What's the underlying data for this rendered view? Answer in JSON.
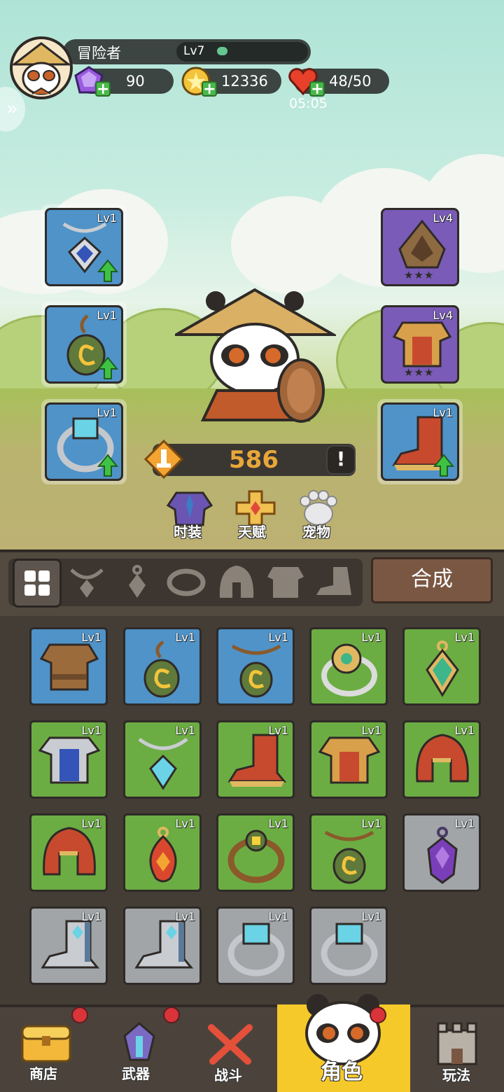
{
  "player": {
    "name": "冒险者",
    "level": "Lv7",
    "level_progress": 0.12,
    "gems": "90",
    "coins": "12336",
    "energy": "48/50",
    "energy_timer": "05:05"
  },
  "equipped": {
    "left": [
      {
        "item": "necklace-blue",
        "level": "Lv1",
        "upgradable": true
      },
      {
        "item": "pendant-green",
        "level": "Lv1",
        "upgradable": true
      },
      {
        "item": "ring-silver",
        "level": "Lv1",
        "upgradable": true
      }
    ],
    "right": [
      {
        "item": "hood-green",
        "level": "Lv4",
        "stars": "★★★",
        "upgradable": false
      },
      {
        "item": "armor-gold",
        "level": "Lv4",
        "stars": "★★★",
        "upgradable": false
      },
      {
        "item": "boot-red",
        "level": "Lv1",
        "upgradable": true
      }
    ]
  },
  "power": "586",
  "functions": {
    "fashion": "时装",
    "talent": "天赋",
    "pet": "宠物"
  },
  "filter": {
    "craft_label": "合成"
  },
  "inventory": [
    {
      "item": "leather-armor",
      "level": "Lv1",
      "rarity": "blue"
    },
    {
      "item": "pendant-green",
      "level": "Lv1",
      "rarity": "blue"
    },
    {
      "item": "pendant-green-bead",
      "level": "Lv1",
      "rarity": "blue"
    },
    {
      "item": "ring-flower",
      "level": "Lv1",
      "rarity": "green"
    },
    {
      "item": "pendant-emerald",
      "level": "Lv1",
      "rarity": "green"
    },
    {
      "item": "armor-blue",
      "level": "Lv1",
      "rarity": "green"
    },
    {
      "item": "necklace-diamond",
      "level": "Lv1",
      "rarity": "green"
    },
    {
      "item": "boot-red",
      "level": "Lv1",
      "rarity": "green"
    },
    {
      "item": "armor-gold",
      "level": "Lv1",
      "rarity": "green"
    },
    {
      "item": "helmet-red",
      "level": "Lv1",
      "rarity": "green"
    },
    {
      "item": "helmet-red",
      "level": "Lv1",
      "rarity": "green"
    },
    {
      "item": "pendant-red",
      "level": "Lv1",
      "rarity": "green"
    },
    {
      "item": "ring-leather",
      "level": "Lv1",
      "rarity": "green"
    },
    {
      "item": "pendant-green-bead",
      "level": "Lv1",
      "rarity": "green"
    },
    {
      "item": "pendant-purple",
      "level": "Lv1",
      "rarity": "gray"
    },
    {
      "item": "boot-steel",
      "level": "Lv1",
      "rarity": "gray"
    },
    {
      "item": "boot-steel",
      "level": "Lv1",
      "rarity": "gray"
    },
    {
      "item": "ring-silver",
      "level": "Lv1",
      "rarity": "gray"
    },
    {
      "item": "ring-silver",
      "level": "Lv1",
      "rarity": "gray"
    }
  ],
  "nav": {
    "shop": "商店",
    "weapon": "武器",
    "battle": "战斗",
    "character": "角色",
    "play": "玩法"
  },
  "colors": {
    "blue": "#4f93c9",
    "purple": "#7a5bb8",
    "green": "#6cad43",
    "gray": "#a1a5a8",
    "power": "#e8a73a",
    "active_nav": "#f6c92a"
  }
}
